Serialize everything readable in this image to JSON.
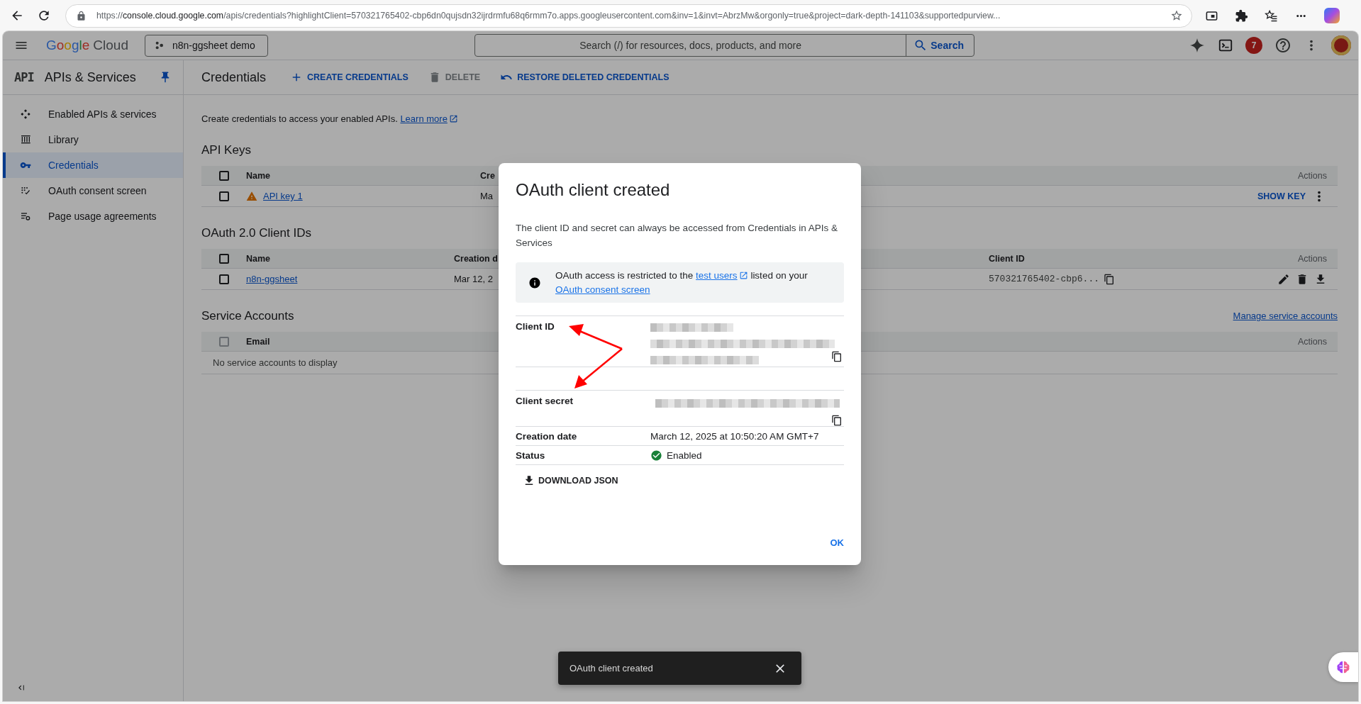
{
  "browser": {
    "url": {
      "scheme": "https://",
      "host": "console.cloud.google.com",
      "path": "/apis/credentials?highlightClient=570321765402-cbp6dn0qujsdn32ijrdrmfu68q6rmm7o.apps.googleusercontent.com&inv=1&invt=AbrzMw&orgonly=true&project=dark-depth-141103&supportedpurview..."
    }
  },
  "header": {
    "logo": {
      "brand": "Google",
      "product": "Cloud"
    },
    "project": "n8n-ggsheet demo",
    "search": {
      "placeholder": "Search (/) for resources, docs, products, and more",
      "button": "Search"
    },
    "notifications": "7"
  },
  "sidebar": {
    "badge": "API",
    "title": "APIs & Services",
    "items": [
      {
        "label": "Enabled APIs & services",
        "selected": false
      },
      {
        "label": "Library",
        "selected": false
      },
      {
        "label": "Credentials",
        "selected": true
      },
      {
        "label": "OAuth consent screen",
        "selected": false
      },
      {
        "label": "Page usage agreements",
        "selected": false
      }
    ]
  },
  "toolbar": {
    "title": "Credentials",
    "actions": [
      {
        "label": "CREATE CREDENTIALS",
        "disabled": false
      },
      {
        "label": "DELETE",
        "disabled": true
      },
      {
        "label": "RESTORE DELETED CREDENTIALS",
        "disabled": false
      }
    ]
  },
  "intro": {
    "text": "Create credentials to access your enabled APIs.",
    "link": "Learn more"
  },
  "sections": [
    {
      "kind": "api_keys",
      "heading": "API Keys",
      "select_all": {
        "checked": false,
        "disabled": false
      },
      "columns": [
        "Name",
        "Cre",
        "Actions"
      ],
      "rows": [
        {
          "checked": false,
          "warning": true,
          "name": "API key 1",
          "created": "Ma",
          "action": "SHOW KEY"
        }
      ]
    },
    {
      "kind": "oauth_clients",
      "heading": "OAuth 2.0 Client IDs",
      "select_all": {
        "checked": false,
        "disabled": false
      },
      "columns": [
        "Name",
        "Creation d",
        "Client ID",
        "Actions"
      ],
      "rows": [
        {
          "checked": false,
          "name": "n8n-ggsheet",
          "created": "Mar 12, 2",
          "client_id": "570321765402-cbp6..."
        }
      ]
    },
    {
      "kind": "service_accounts",
      "heading": "Service Accounts",
      "link": "Manage service accounts",
      "select_all": {
        "checked": false,
        "disabled": true
      },
      "columns": [
        "Email",
        "Actions"
      ],
      "empty": "No service accounts to display"
    }
  ],
  "dialog": {
    "title": "OAuth client created",
    "description": "The client ID and secret can always be accessed from Credentials in APIs & Services",
    "notice": [
      {
        "kind": "text",
        "text": "OAuth access is restricted to the "
      },
      {
        "kind": "link",
        "text": "test users",
        "external": true
      },
      {
        "kind": "text",
        "text": " listed on your "
      },
      {
        "kind": "link",
        "text": "OAuth consent screen",
        "external": false
      }
    ],
    "fields": [
      {
        "kind": "secret",
        "label": "Client ID"
      },
      {
        "kind": "secret",
        "label": "Client secret"
      },
      {
        "kind": "text",
        "label": "Creation date",
        "value": "March 12, 2025 at 10:50:20 AM GMT+7"
      },
      {
        "kind": "status",
        "label": "Status",
        "value": "Enabled",
        "enabled": true
      }
    ],
    "download": "DOWNLOAD JSON",
    "ok": "OK"
  },
  "toast": {
    "text": "OAuth client created"
  }
}
